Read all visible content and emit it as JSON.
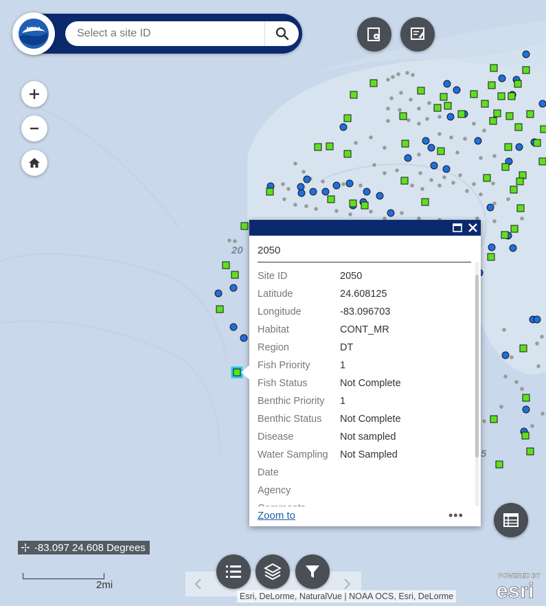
{
  "search": {
    "placeholder": "Select a site ID"
  },
  "map_labels": {
    "contour_label_left": "20",
    "contour_label_right": "5"
  },
  "popup": {
    "title": "2050",
    "attributes": [
      {
        "key": "Site ID",
        "value": "2050"
      },
      {
        "key": "Latitude",
        "value": "24.608125"
      },
      {
        "key": "Longitude",
        "value": "-83.096703"
      },
      {
        "key": "Habitat",
        "value": "CONT_MR"
      },
      {
        "key": "Region",
        "value": "DT"
      },
      {
        "key": "Fish Priority",
        "value": "1"
      },
      {
        "key": "Fish Status",
        "value": "Not Complete"
      },
      {
        "key": "Benthic Priority",
        "value": "1"
      },
      {
        "key": "Benthic Status",
        "value": "Not Complete"
      },
      {
        "key": "Disease",
        "value": "Not sampled"
      },
      {
        "key": "Water Sampling",
        "value": "Not Sampled"
      },
      {
        "key": "Date",
        "value": ""
      },
      {
        "key": "Agency",
        "value": ""
      },
      {
        "key": "Comments",
        "value": ""
      }
    ],
    "zoom_label": "Zoom to",
    "more_label": "•••"
  },
  "coordinates": {
    "text": "-83.097 24.608 Degrees"
  },
  "scalebar": {
    "label": "2mi"
  },
  "attribution": {
    "text": "Esri, DeLorme, NaturalVue | NOAA OCS, Esri, DeLorme"
  },
  "branding": {
    "powered_by": "POWERED BY",
    "esri": "esri",
    "noaa": "NOAA"
  },
  "colors": {
    "header": "#0b2a6e",
    "square_site": "#5fe01e",
    "circle_site": "#1e6fe0",
    "gray_dot": "#9a9a9a",
    "water": "#c9d8ea",
    "shelf": "#d9e4f1"
  }
}
